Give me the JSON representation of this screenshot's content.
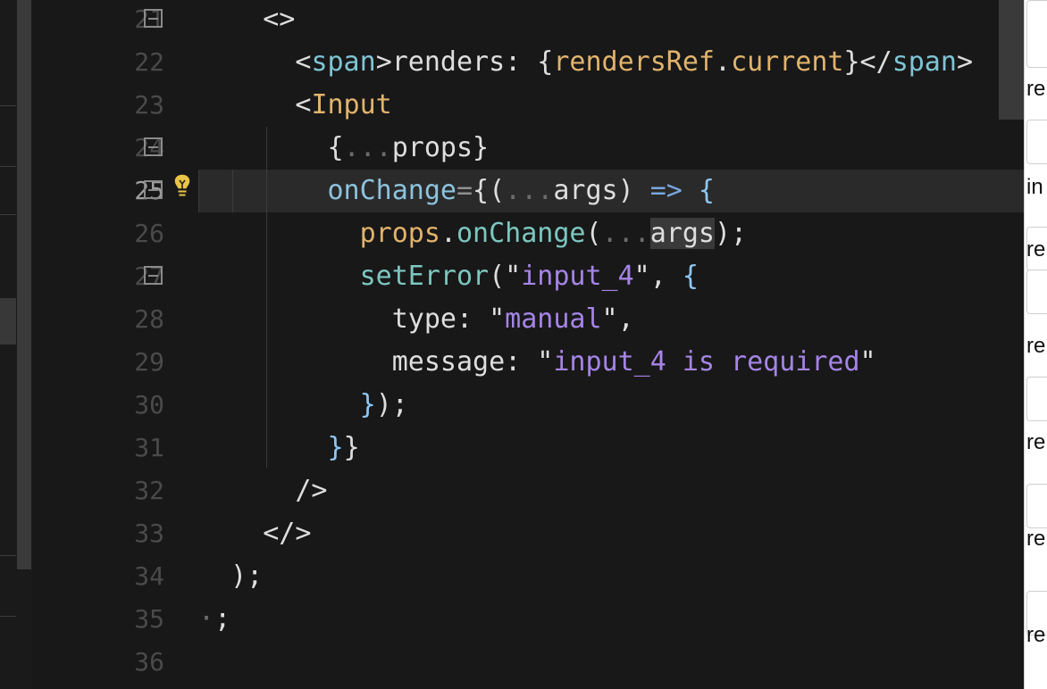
{
  "editor": {
    "lines": [
      {
        "number": "21",
        "tokens": [
          [
            "def",
            "    <>"
          ]
        ],
        "fold": true
      },
      {
        "number": "22",
        "tokens": [
          [
            "def",
            "      <"
          ],
          [
            "tag",
            "span"
          ],
          [
            "def",
            ">renders: {"
          ],
          [
            "var",
            "rendersRef"
          ],
          [
            "def",
            "."
          ],
          [
            "prop",
            "current"
          ],
          [
            "def",
            "}</"
          ],
          [
            "tag",
            "span"
          ],
          [
            "def",
            ">"
          ]
        ],
        "fold": false
      },
      {
        "number": "23",
        "tokens": [
          [
            "def",
            "      <"
          ],
          [
            "comp",
            "Input"
          ]
        ],
        "fold": false
      },
      {
        "number": "24",
        "tokens": [
          [
            "def",
            "        {"
          ],
          [
            "dim",
            "..."
          ],
          [
            "def",
            "props}"
          ]
        ],
        "fold": true
      },
      {
        "number": "25",
        "tokens": [
          [
            "attr",
            "        onChange"
          ],
          [
            "op",
            "="
          ],
          [
            "def",
            "{("
          ],
          [
            "dim",
            "..."
          ],
          [
            "def",
            "args) "
          ],
          [
            "arrow",
            "=>"
          ],
          [
            "def",
            " "
          ],
          [
            "brace",
            "{"
          ]
        ],
        "fold": true,
        "active": true
      },
      {
        "number": "26",
        "tokens": [
          [
            "var",
            "          props"
          ],
          [
            "def",
            "."
          ],
          [
            "func",
            "onChange"
          ],
          [
            "def",
            "("
          ],
          [
            "dim",
            "..."
          ],
          [
            "hl",
            "args"
          ],
          [
            "def",
            ");"
          ]
        ],
        "fold": false
      },
      {
        "number": "27",
        "tokens": [
          [
            "func",
            "          setError"
          ],
          [
            "def",
            "(\""
          ],
          [
            "str",
            "input_4"
          ],
          [
            "def",
            "\", "
          ],
          [
            "brace",
            "{"
          ]
        ],
        "fold": true
      },
      {
        "number": "28",
        "tokens": [
          [
            "def",
            "            type: \""
          ],
          [
            "str",
            "manual"
          ],
          [
            "def",
            "\","
          ]
        ],
        "fold": false
      },
      {
        "number": "29",
        "tokens": [
          [
            "def",
            "            message: \""
          ],
          [
            "str",
            "input_4 is required"
          ],
          [
            "def",
            "\""
          ]
        ],
        "fold": false
      },
      {
        "number": "30",
        "tokens": [
          [
            "brace",
            "          }"
          ],
          [
            "def",
            ");"
          ]
        ],
        "fold": false
      },
      {
        "number": "31",
        "tokens": [
          [
            "brace",
            "        }"
          ],
          [
            "def",
            "}"
          ]
        ],
        "fold": false
      },
      {
        "number": "32",
        "tokens": [
          [
            "def",
            "      />"
          ]
        ],
        "fold": false
      },
      {
        "number": "33",
        "tokens": [
          [
            "def",
            "    </>"
          ]
        ],
        "fold": false
      },
      {
        "number": "34",
        "tokens": [
          [
            "def",
            "  );"
          ]
        ],
        "fold": false
      },
      {
        "number": "35",
        "tokens": [
          [
            "dim",
            "·"
          ],
          [
            "def",
            ";"
          ]
        ],
        "fold": false
      },
      {
        "number": "36",
        "tokens": [],
        "fold": false
      }
    ]
  },
  "right_panel": {
    "labels": [
      "re",
      "in",
      "re",
      "re",
      "re",
      "re",
      "re"
    ]
  },
  "colors": {
    "background": "#181818",
    "current_line": "#2a2a2a",
    "string": "#a585e6",
    "tag": "#7fc4d4",
    "variable": "#e2b36c"
  },
  "icons": {
    "bulb": "lightbulb-icon",
    "fold": "fold-collapse-icon"
  }
}
